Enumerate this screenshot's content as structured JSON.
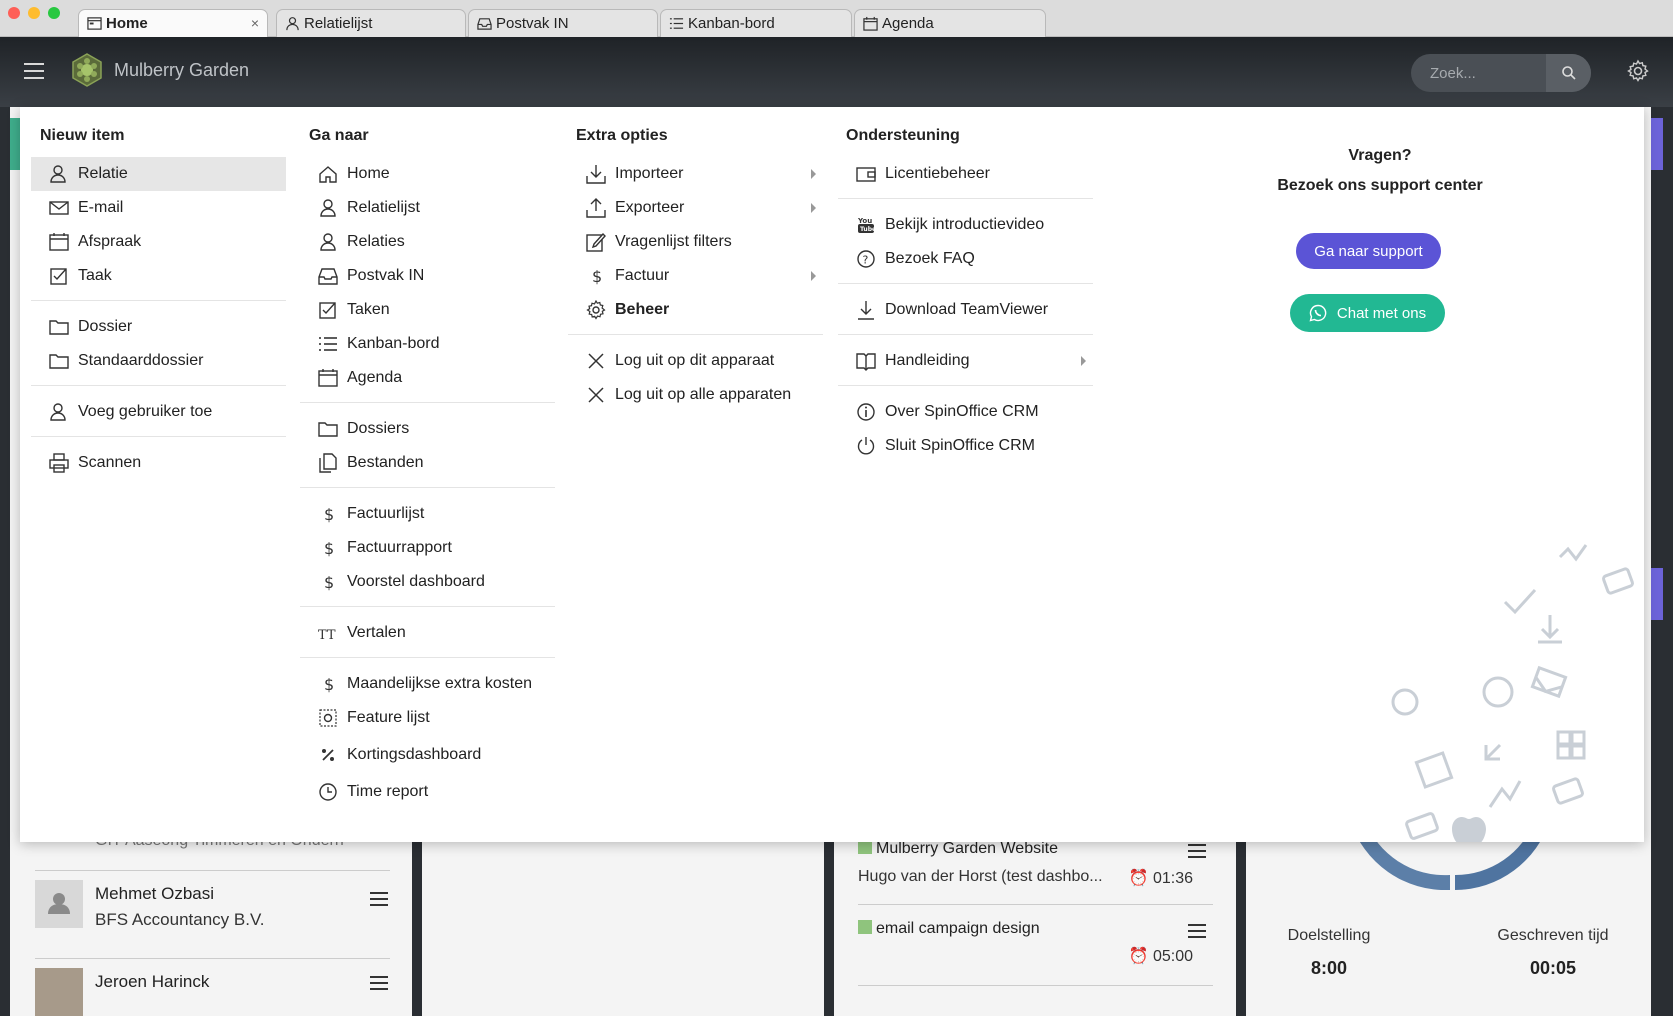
{
  "browser": {
    "tabs": [
      {
        "label": "Home",
        "active": true
      },
      {
        "label": "Relatielijst"
      },
      {
        "label": "Postvak IN"
      },
      {
        "label": "Kanban-bord"
      },
      {
        "label": "Agenda"
      }
    ],
    "close_glyph": "×"
  },
  "header": {
    "brand": "Mulberry Garden",
    "search_placeholder": "Zoek..."
  },
  "menu": {
    "nieuw_item": {
      "title": "Nieuw item",
      "items": [
        "Relatie",
        "E-mail",
        "Afspraak",
        "Taak",
        "Dossier",
        "Standaarddossier",
        "Voeg gebruiker toe",
        "Scannen"
      ]
    },
    "ga_naar": {
      "title": "Ga naar",
      "items": [
        "Home",
        "Relatielijst",
        "Relaties",
        "Postvak IN",
        "Taken",
        "Kanban-bord",
        "Agenda",
        "Dossiers",
        "Bestanden",
        "Factuurlijst",
        "Factuurrapport",
        "Voorstel dashboard",
        "Vertalen",
        "Maandelijkse extra kosten",
        "Feature lijst",
        "Kortingsdashboard",
        "Time report"
      ]
    },
    "extra_opties": {
      "title": "Extra opties",
      "items": [
        "Importeer",
        "Exporteer",
        "Vragenlijst filters",
        "Factuur",
        "Beheer",
        "Log uit op dit apparaat",
        "Log uit op alle apparaten"
      ]
    },
    "ondersteuning": {
      "title": "Ondersteuning",
      "items": [
        "Licentiebeheer",
        "Bekijk introductievideo",
        "Bezoek FAQ",
        "Download TeamViewer",
        "Handleiding",
        "Over SpinOffice CRM",
        "Sluit SpinOffice CRM"
      ]
    },
    "support": {
      "question": "Vragen?",
      "subtitle": "Bezoek ons support center",
      "support_button": "Ga naar support",
      "chat_button": "Chat met ons"
    }
  },
  "background": {
    "contacts": [
      {
        "name": "Mehmet Ozbasi",
        "company": "BFS Accountancy B.V."
      },
      {
        "name": "Jeroen Harinck",
        "company": ""
      }
    ],
    "partial_text": "GIT Aaseong Timmeren en Onderh",
    "tasks": [
      {
        "title": "Mulberry Garden Website",
        "sub": "Hugo van der Horst (test dashbo...",
        "time": "01:36"
      },
      {
        "title": "email campaign design",
        "sub": "",
        "time": "05:00"
      }
    ],
    "stats": [
      {
        "label": "Doelstelling",
        "value": "8:00"
      },
      {
        "label": "Geschreven tijd",
        "value": "00:05"
      }
    ]
  },
  "colors": {
    "purple": "#5b54d6",
    "green": "#22b893",
    "highlight": "#e6e6e6"
  }
}
